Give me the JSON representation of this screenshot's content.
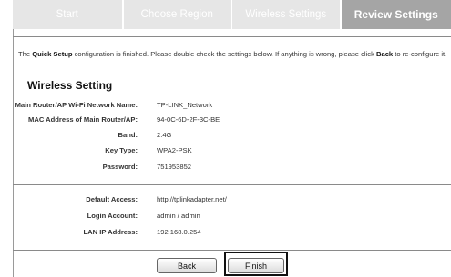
{
  "tabs": [
    {
      "label": "Start"
    },
    {
      "label": "Choose Region"
    },
    {
      "label": "Wireless Settings"
    },
    {
      "label": "Review Settings"
    }
  ],
  "intro": {
    "part1": "The ",
    "bold1": "Quick Setup",
    "part2": " configuration is finished. Please double check the settings below. If anything is wrong, please click ",
    "bold2": "Back",
    "part3": " to re-configure it."
  },
  "section_title": "Wireless Setting",
  "wireless": [
    {
      "label": "Main Router/AP Wi-Fi Network Name:",
      "value": "TP-LINK_Network"
    },
    {
      "label": "MAC Address of Main Router/AP:",
      "value": "94-0C-6D-2F-3C-BE"
    },
    {
      "label": "Band:",
      "value": "2.4G"
    },
    {
      "label": "Key Type:",
      "value": "WPA2-PSK"
    },
    {
      "label": "Password:",
      "value": "751953852"
    }
  ],
  "access": [
    {
      "label": "Default Access:",
      "value": "http://tplinkadapter.net/"
    },
    {
      "label": "Login Account:",
      "value": "admin / admin"
    },
    {
      "label": "LAN IP Address:",
      "value": "192.168.0.254"
    }
  ],
  "buttons": {
    "back": "Back",
    "finish": "Finish"
  }
}
